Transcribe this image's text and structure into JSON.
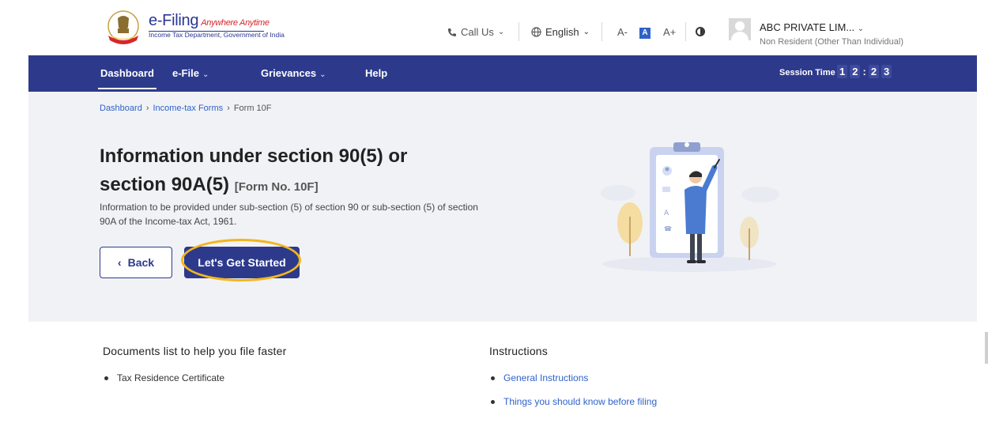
{
  "header": {
    "logo_title": "e-Filing",
    "logo_tagline": "Anywhere Anytime",
    "logo_subtitle": "Income Tax Department, Government of India",
    "call_us": "Call Us",
    "language": "English",
    "font_decrease": "A-",
    "font_default": "A",
    "font_increase": "A+",
    "user_name": "ABC PRIVATE LIM...",
    "user_type": "Non Resident (Other Than Individual)"
  },
  "nav": {
    "items": [
      {
        "label": "Dashboard",
        "active": true
      },
      {
        "label": "e-File",
        "dropdown": true
      },
      {
        "label": "Grievances",
        "dropdown": true
      },
      {
        "label": "Help"
      }
    ],
    "session_label": "Session Time",
    "session_digits": [
      "1",
      "2",
      "2",
      "3"
    ]
  },
  "breadcrumb": {
    "items": [
      "Dashboard",
      "Income-tax Forms",
      "Form 10F"
    ]
  },
  "hero": {
    "title": "Information under section 90(5) or section 90A(5)",
    "form_no": "[Form No. 10F]",
    "description": "Information to be provided under sub-section (5) of section 90 or sub-section (5) of section 90A of the Income-tax Act, 1961.",
    "back_label": "Back",
    "start_label": "Let's Get Started"
  },
  "documents": {
    "title": "Documents list to help you file faster",
    "items": [
      "Tax Residence Certificate"
    ]
  },
  "instructions": {
    "title": "Instructions",
    "items": [
      "General Instructions",
      "Things you should know before filing"
    ]
  },
  "colors": {
    "brand_navy": "#2d3a8c",
    "link_blue": "#2f62c9",
    "highlight": "#f2b61e",
    "hero_bg": "#f1f2f5"
  }
}
